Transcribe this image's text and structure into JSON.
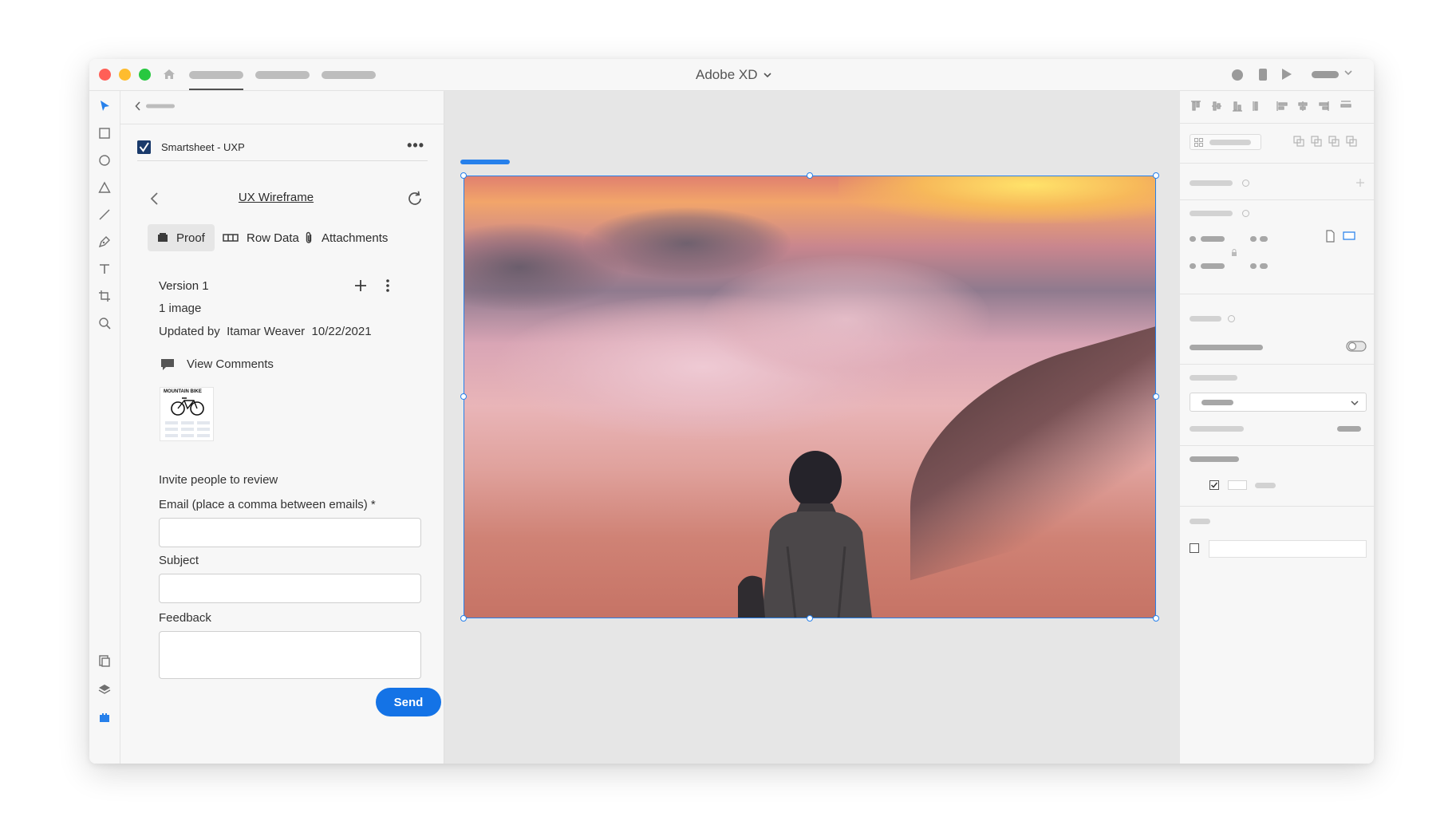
{
  "window": {
    "app_title": "Adobe XD"
  },
  "plugin": {
    "name": "Smartsheet - UXP",
    "sheet_title": "UX Wireframe",
    "tabs": [
      {
        "label": "Proof"
      },
      {
        "label": "Row Data"
      },
      {
        "label": "Attachments"
      }
    ],
    "version": {
      "title": "Version 1",
      "image_count": "1 image",
      "updated_label": "Updated by",
      "updated_by": "Itamar Weaver",
      "updated_date": "10/22/2021"
    },
    "view_comments": "View Comments",
    "thumbnail_title": "MOUNTAIN BIKE",
    "invite": {
      "heading": "Invite people to review",
      "email_label": "Email (place a comma between emails) *",
      "email_value": "",
      "subject_label": "Subject",
      "subject_value": "",
      "feedback_label": "Feedback",
      "feedback_value": "",
      "send_label": "Send"
    }
  },
  "colors": {
    "accent": "#2680eb",
    "send_button": "#1473e6",
    "smartsheet_brand": "#1a3a6b"
  },
  "icons": {
    "toolbar": [
      "select-icon",
      "rectangle-icon",
      "ellipse-icon",
      "triangle-icon",
      "line-icon",
      "pen-icon",
      "text-icon",
      "artboard-icon",
      "zoom-icon"
    ],
    "toolbar_bottom": [
      "assets-icon",
      "layers-icon",
      "plugins-icon"
    ]
  }
}
